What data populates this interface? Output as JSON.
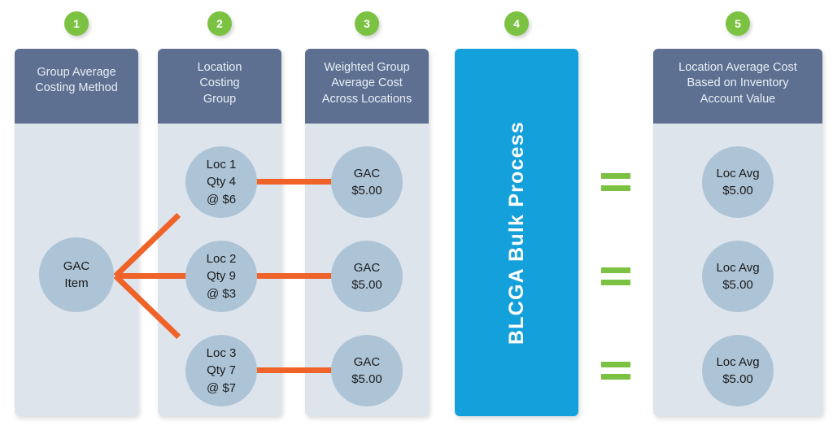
{
  "diagram": {
    "title": "Group Average Costing flow",
    "colors": {
      "badge_green": "#7cc242",
      "panel_header": "#5d7091",
      "panel_body": "#dde4ec",
      "process_blue": "#14a0db",
      "node_blue": "#adc4d7",
      "connector_orange": "#ef6228",
      "equals_green": "#7cc242"
    }
  },
  "badges": [
    {
      "number": "1"
    },
    {
      "number": "2"
    },
    {
      "number": "3"
    },
    {
      "number": "4"
    },
    {
      "number": "5"
    }
  ],
  "panels": [
    {
      "id": "group-average-costing-method",
      "title": "Group Average\nCosting Method"
    },
    {
      "id": "location-costing-group",
      "title": "Location\nCosting\nGroup"
    },
    {
      "id": "weighted-group-average-cost",
      "title": "Weighted Group\nAverage Cost\nAcross Locations"
    },
    {
      "id": "blcga-bulk-process",
      "title": "BLCGA Bulk  Process"
    },
    {
      "id": "location-average-cost",
      "title": "Location Average Cost\nBased on Inventory\nAccount Value"
    }
  ],
  "nodes": {
    "source": {
      "line1": "GAC",
      "line2": "Item"
    },
    "locations": [
      {
        "line1": "Loc 1",
        "line2": "Qty 4",
        "line3": "@ $6"
      },
      {
        "line1": "Loc 2",
        "line2": "Qty 9",
        "line3": "@ $3"
      },
      {
        "line1": "Loc 3",
        "line2": "Qty 7",
        "line3": "@ $7"
      }
    ],
    "gac_results": [
      {
        "line1": "GAC",
        "line2": "$5.00"
      },
      {
        "line1": "GAC",
        "line2": "$5.00"
      },
      {
        "line1": "GAC",
        "line2": "$5.00"
      }
    ],
    "loc_averages": [
      {
        "line1": "Loc Avg",
        "line2": "$5.00"
      },
      {
        "line1": "Loc Avg",
        "line2": "$5.00"
      },
      {
        "line1": "Loc Avg",
        "line2": "$5.00"
      }
    ]
  },
  "equals": [
    {
      "symbol": "="
    },
    {
      "symbol": "="
    },
    {
      "symbol": "="
    }
  ]
}
